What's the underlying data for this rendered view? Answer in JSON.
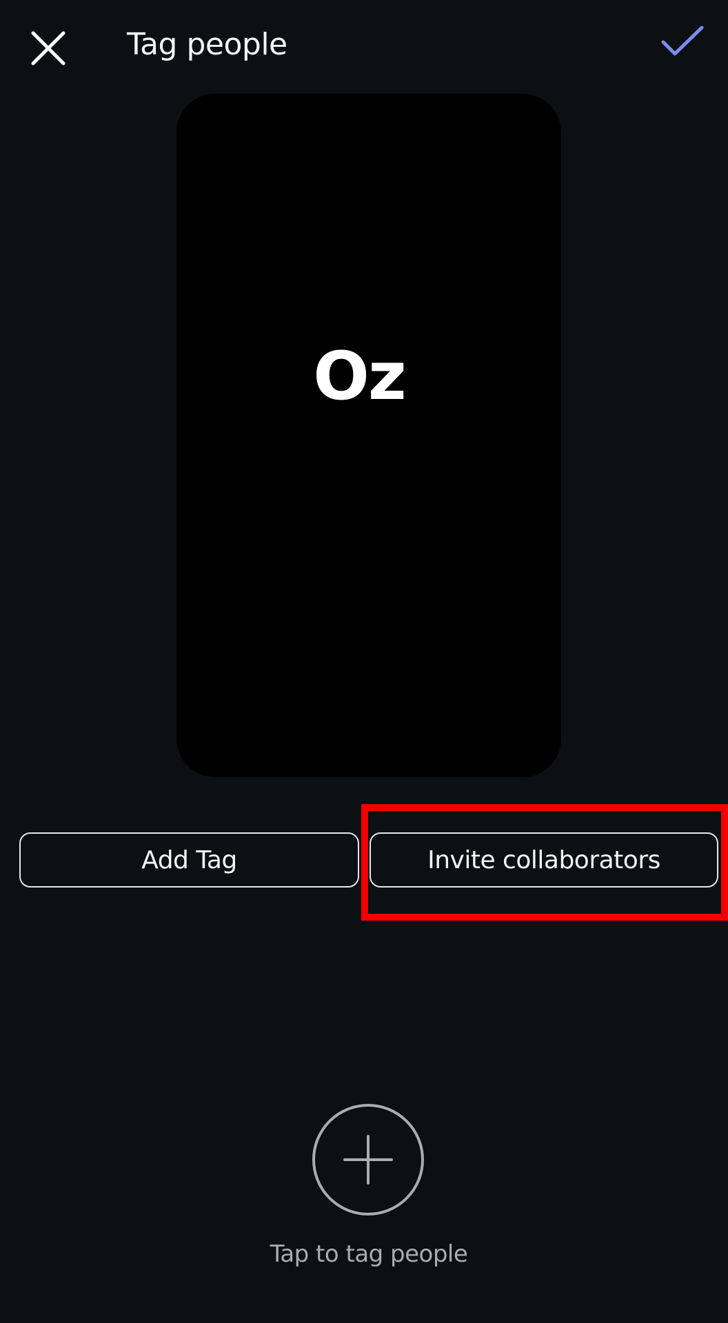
{
  "header": {
    "title": "Tag people",
    "close_icon": "close-icon",
    "done_icon": "checkmark-icon",
    "accent_color": "#7a8ef0"
  },
  "preview": {
    "text": "Oz"
  },
  "actions": {
    "add_tag_label": "Add Tag",
    "invite_label": "Invite collaborators",
    "highlight_color": "#f20000"
  },
  "tag_area": {
    "add_icon": "plus-icon",
    "hint": "Tap to tag people"
  }
}
